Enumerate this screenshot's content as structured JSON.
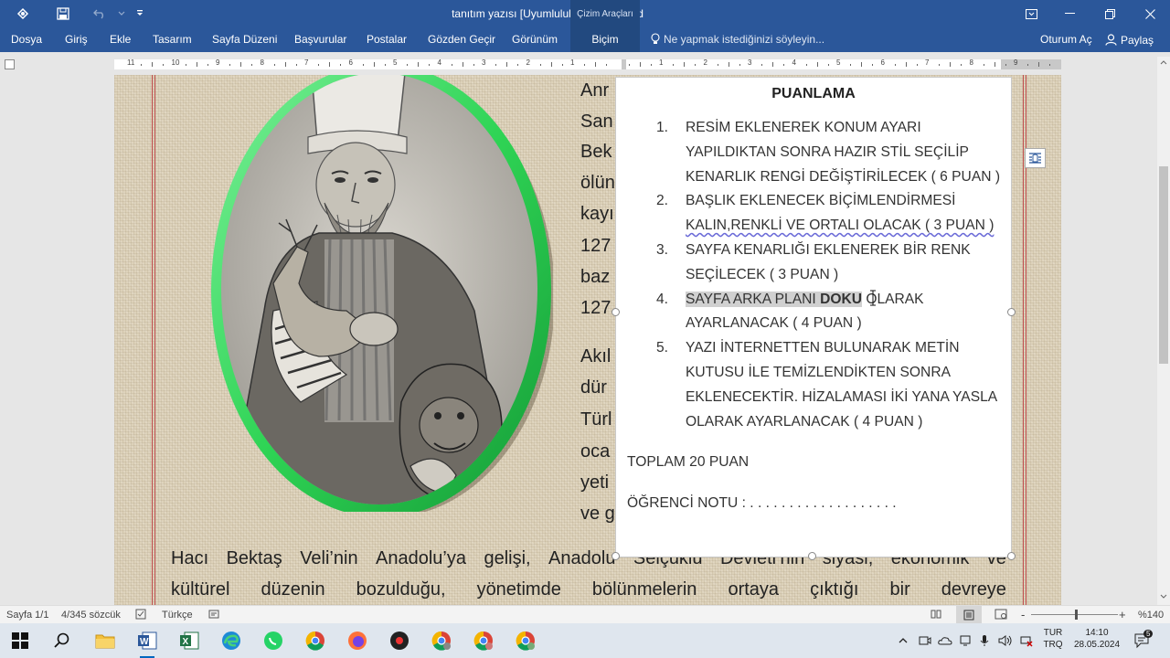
{
  "window": {
    "title": "tanıtım yazısı [Uyumluluk Modu] - Word",
    "context_group": "Çizim Araçları"
  },
  "ribbon": {
    "tabs": [
      {
        "label": "Dosya"
      },
      {
        "label": "Giriş"
      },
      {
        "label": "Ekle"
      },
      {
        "label": "Tasarım"
      },
      {
        "label": "Sayfa Düzeni"
      },
      {
        "label": "Başvurular"
      },
      {
        "label": "Postalar"
      },
      {
        "label": "Gözden Geçir"
      },
      {
        "label": "Görünüm"
      },
      {
        "label": "Biçim"
      }
    ],
    "tell_me": "Ne yapmak istediğinizi söyleyin...",
    "signin": "Oturum Aç",
    "share": "Paylaş"
  },
  "ruler": {
    "numbers": [
      "11",
      "10",
      "9",
      "8",
      "7",
      "6",
      "5",
      "4",
      "3",
      "2",
      "1",
      "",
      "1",
      "2",
      "3",
      "4",
      "5",
      "6",
      "7",
      "8",
      "9"
    ]
  },
  "document": {
    "side_words": [
      "Anr",
      "San",
      "Bek",
      "ölün",
      "kayı",
      "127",
      "baz",
      "127",
      "Akıl",
      "dür",
      "Türl",
      "oca",
      "yeti",
      "ve g"
    ],
    "paragraph_lines": [
      [
        "Hacı",
        "Bektaş",
        "Veli’nin",
        "Anadolu’ya",
        "gelişi,",
        "Anadolu",
        "Selçuklu",
        "Devleti’nin",
        "siyasi,",
        "ekonomik",
        "ve"
      ],
      [
        "kültürel",
        "düzenin",
        "bozulduğu,",
        "yönetimde",
        "bölünmelerin",
        "ortaya",
        "çıktığı",
        "bir",
        "devreye"
      ]
    ]
  },
  "textbox": {
    "title": "PUANLAMA",
    "items": [
      {
        "num": "1.",
        "lines": [
          "RESİM EKLENEREK KONUM AYARI",
          "YAPILDIKTAN SONRA HAZIR STİL SEÇİLİP",
          "KENARLIK RENGİ DEĞİŞTİRİLECEK ( 6 PUAN )"
        ]
      },
      {
        "num": "2.",
        "lines": [
          "BAŞLIK EKLENECEK BİÇİMLENDİRMESİ",
          "KALIN,RENKLİ VE ORTALI OLACAK ( 3 PUAN )"
        ]
      },
      {
        "num": "3.",
        "lines": [
          "SAYFA KENARLIĞI EKLENEREK BİR RENK",
          "SEÇİLECEK ( 3 PUAN )"
        ]
      },
      {
        "num": "4.",
        "lines": [
          "SAYFA ARKA PLANI DOKU OLARAK",
          "AYARLANACAK ( 4 PUAN )"
        ],
        "highlight": "SAYFA ARKA PLANI ",
        "bold": "DOKU",
        "rest": " OLARAK"
      },
      {
        "num": "5.",
        "lines": [
          "YAZI İNTERNETTEN BULUNARAK METİN",
          "KUTUSU İLE TEMİZLENDİKTEN SONRA",
          "EKLENECEKTİR. HİZALAMASI İKİ YANA YASLA",
          "OLARAK AYARLANACAK ( 4 PUAN )"
        ]
      }
    ],
    "total": "TOPLAM 20 PUAN",
    "student_note": "ÖĞRENCİ NOTU : . . . . . . . . . . . . . . . . . . ."
  },
  "statusbar": {
    "page": "Sayfa 1/1",
    "words": "4/345 sözcük",
    "language": "Türkçe",
    "zoom": "%140",
    "zoom_minus": "-",
    "zoom_plus": "+"
  },
  "taskbar": {
    "lang_top": "TUR",
    "lang_bottom": "TRQ",
    "time": "14:10",
    "date": "28.05.2024",
    "notification_count": "5"
  },
  "colors": {
    "word_blue": "#2b579a",
    "frame_green": "#2fd455",
    "page_border_red": "#c05050"
  }
}
